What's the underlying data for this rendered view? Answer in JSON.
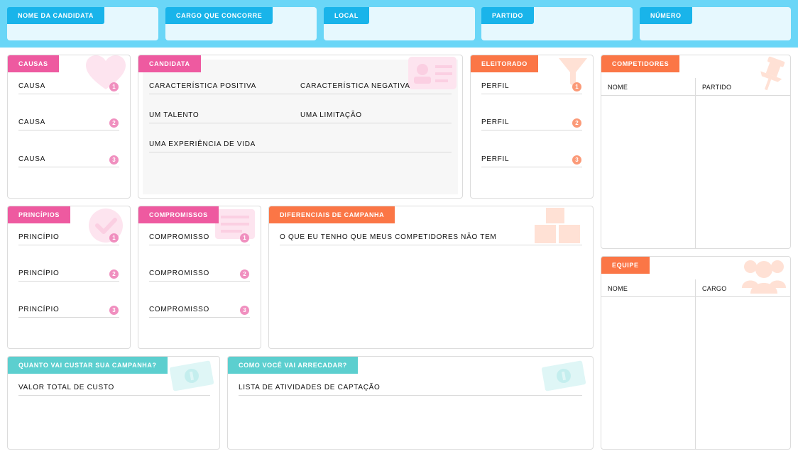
{
  "header": {
    "fields": [
      {
        "label": "NOME DA CANDIDATA"
      },
      {
        "label": "CARGO QUE CONCORRE"
      },
      {
        "label": "LOCAL"
      },
      {
        "label": "PARTIDO"
      },
      {
        "label": "NÚMERO"
      }
    ]
  },
  "causas": {
    "title": "CAUSAS",
    "items": [
      {
        "label": "CAUSA",
        "num": "1"
      },
      {
        "label": "CAUSA",
        "num": "2"
      },
      {
        "label": "CAUSA",
        "num": "3"
      }
    ]
  },
  "candidata": {
    "title": "CANDIDATA",
    "positiva": "CARACTERÍSTICA POSITIVA",
    "negativa": "CARACTERÍSTICA NEGATIVA",
    "talento": "UM TALENTO",
    "limitacao": "UMA LIMITAÇÃO",
    "experiencia": "UMA EXPERIÊNCIA DE VIDA"
  },
  "eleitorado": {
    "title": "ELEITORADO",
    "items": [
      {
        "label": "PERFIL",
        "num": "1"
      },
      {
        "label": "PERFIL",
        "num": "2"
      },
      {
        "label": "PERFIL",
        "num": "3"
      }
    ]
  },
  "competidores": {
    "title": "COMPETIDORES",
    "col1": "NOME",
    "col2": "PARTIDO"
  },
  "principios": {
    "title": "PRINCÍPIOS",
    "items": [
      {
        "label": "PRINCÍPIO",
        "num": "1"
      },
      {
        "label": "PRINCÍPIO",
        "num": "2"
      },
      {
        "label": "PRINCÍPIO",
        "num": "3"
      }
    ]
  },
  "compromissos": {
    "title": "COMPROMISSOS",
    "items": [
      {
        "label": "COMPROMISSO",
        "num": "1"
      },
      {
        "label": "COMPROMISSO",
        "num": "2"
      },
      {
        "label": "COMPROMISSO",
        "num": "3"
      }
    ]
  },
  "diferenciais": {
    "title": "DIFERENCIAIS DE CAMPANHA",
    "label": "O QUE EU TENHO QUE MEUS COMPETIDORES NÃO TEM"
  },
  "equipe": {
    "title": "EQUIPE",
    "col1": "NOME",
    "col2": "CARGO"
  },
  "custo": {
    "title": "QUANTO VAI CUSTAR SUA CAMPANHA?",
    "label": "VALOR TOTAL DE CUSTO"
  },
  "arrecadar": {
    "title": "COMO VOCÊ VAI ARRECADAR?",
    "label": "LISTA DE ATIVIDADES DE CAPTAÇÃO"
  },
  "colors": {
    "header_bg": "#6ad6f7",
    "header_tag": "#19b4ea",
    "pink": "#ee5aa0",
    "orange": "#fb7646",
    "teal": "#5ccfcf"
  },
  "icons": [
    "heart-icon",
    "id-card-icon",
    "funnel-icon",
    "pushpin-icon",
    "check-icon",
    "list-icon",
    "boxes-icon",
    "people-icon",
    "banknote-icon"
  ]
}
